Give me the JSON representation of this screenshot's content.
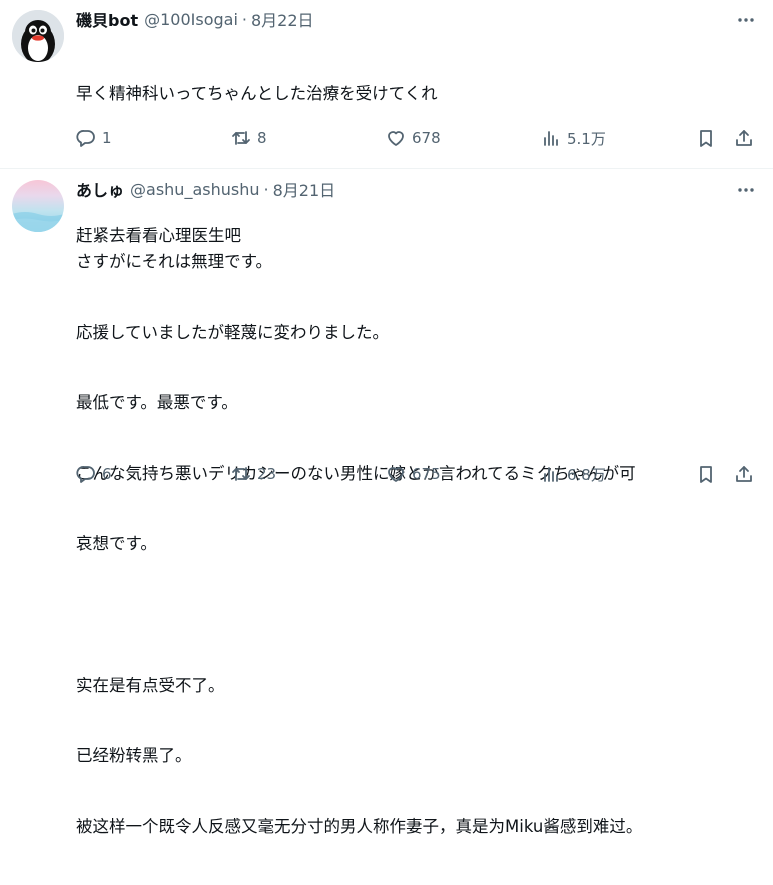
{
  "tweets": [
    {
      "author_name": "磯貝bot",
      "handle": "@100Isogai",
      "date": "8月22日",
      "avatar_icon": "penguin-avatar",
      "lines": [
        "早く精神科いってちゃんとした治療を受けてくれ",
        "",
        "赶紧去看看心理医生吧"
      ],
      "stats": {
        "replies": "1",
        "retweets": "8",
        "likes": "678",
        "views": "5.1万"
      }
    },
    {
      "author_name": "あしゅ",
      "handle": "@ashu_ashushu",
      "date": "8月21日",
      "avatar_icon": "sky-gradient-avatar",
      "lines": [
        "さすがにそれは無理です。",
        "応援していましたが軽蔑に変わりました。",
        "最低です。最悪です。",
        "こんな気持ち悪いデリカシーのない男性に嫁とか言われてるミクちゃんが可",
        "哀想です。",
        "",
        "实在是有点受不了。",
        "已经粉转黑了。",
        "被这样一个既令人反感又毫无分寸的男人称作妻子，真是为Miku酱感到难过。"
      ],
      "stats": {
        "replies": "6",
        "retweets": "23",
        "likes": "675",
        "views": "6.8万"
      }
    }
  ],
  "ui": {
    "separator": "·",
    "icons": [
      "more-icon",
      "reply-icon",
      "retweet-icon",
      "like-icon",
      "views-icon",
      "bookmark-icon",
      "share-icon"
    ]
  }
}
